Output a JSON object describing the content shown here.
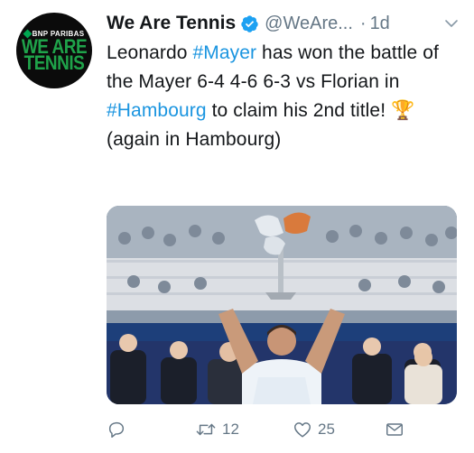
{
  "account": {
    "display_name": "We Are Tennis",
    "handle": "@WeAre...",
    "separator": "·",
    "time": "1d",
    "avatar": {
      "sponsor_text": "BNP PARIBAS",
      "logo_line1": "WE ARE",
      "logo_line2": "TENNIS"
    }
  },
  "tweet": {
    "segments": [
      {
        "text": "Leonardo ",
        "type": "text"
      },
      {
        "text": "#Mayer",
        "type": "hashtag"
      },
      {
        "text": " has won the battle of the Mayer 6-4 4-6 6-3 vs Florian in ",
        "type": "text"
      },
      {
        "text": "#Hambourg",
        "type": "hashtag"
      },
      {
        "text": " to claim his 2nd title! ",
        "type": "text"
      },
      {
        "text": "🏆",
        "type": "emoji"
      },
      {
        "text": " (again in Hambourg)",
        "type": "text"
      }
    ]
  },
  "actions": {
    "reply_count": "",
    "retweet_count": "12",
    "like_count": "25"
  },
  "colors": {
    "text": "#14171a",
    "secondary": "#657786",
    "hashtag": "#1b95e0",
    "verified": "#1da1f2",
    "logo_green": "#1fa34a"
  }
}
